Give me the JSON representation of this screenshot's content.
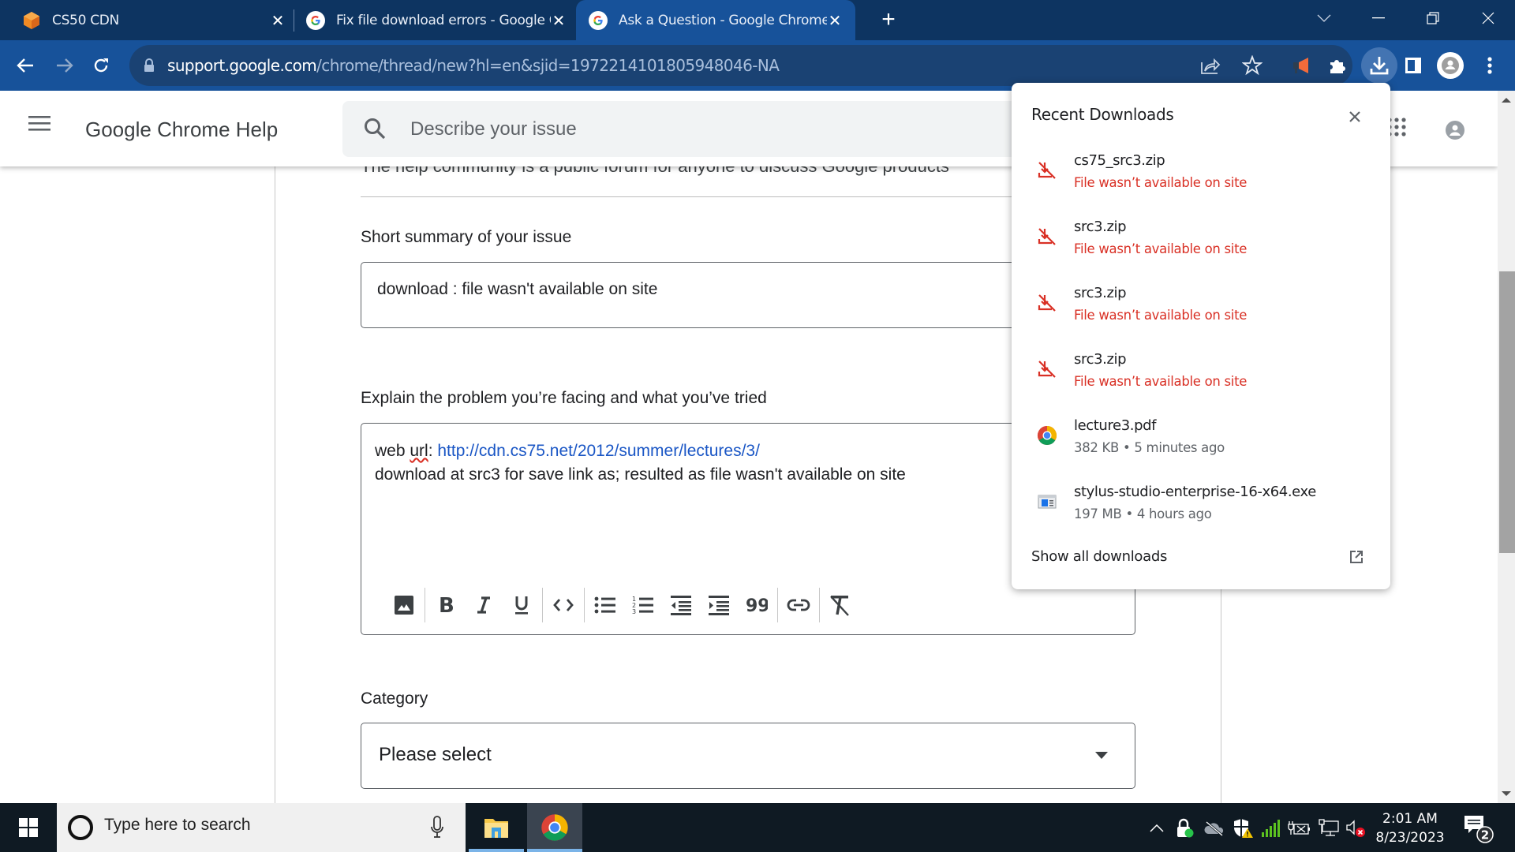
{
  "browser": {
    "tabs": [
      {
        "title": "CS50 CDN",
        "favicon": "cs50-cube-icon",
        "active": false
      },
      {
        "title": "Fix file download errors - Google Chrome Help",
        "favicon": "google-g-icon",
        "active": false
      },
      {
        "title": "Ask a Question - Google Chrome Help",
        "favicon": "google-g-icon",
        "active": true
      }
    ],
    "new_tab_label": "+",
    "url_host": "support.google.com",
    "url_path": "/chrome/thread/new?hl=en&sjid=1972214101805948046-NA",
    "toolbar_icons": [
      "back-icon",
      "forward-icon",
      "reload-icon",
      "share-icon",
      "bookmark-star-icon",
      "megaphone-extension-icon",
      "extensions-puzzle-icon",
      "downloads-icon",
      "side-panel-icon",
      "profile-icon",
      "menu-kebab-icon"
    ]
  },
  "page": {
    "site_title": "Google Chrome Help",
    "search_placeholder": "Describe your issue",
    "intro_text": "The help community is a public forum for anyone to discuss Google products",
    "summary_label": "Short summary of your issue",
    "summary_value": "download : file wasn't available on site",
    "details_label": "Explain the problem you’re facing and what you’ve tried",
    "details_prefix": "web ",
    "details_misspelled": "url",
    "details_colon": ": ",
    "details_link": "http://cdn.cs75.net/2012/summer/lectures/3/",
    "details_line2": "download at src3 for save link as; resulted as file wasn't available on site",
    "editor_tools": [
      "insert-image",
      "bold",
      "italic",
      "underline",
      "code",
      "bulleted-list",
      "numbered-list",
      "decrease-indent",
      "increase-indent",
      "quote",
      "link",
      "clear-formatting"
    ],
    "category_label": "Category",
    "category_value": "Please select"
  },
  "downloads": {
    "title": "Recent Downloads",
    "items": [
      {
        "name": "cs75_src3.zip",
        "status": "File wasn’t available on site",
        "state": "error"
      },
      {
        "name": "src3.zip",
        "status": "File wasn’t available on site",
        "state": "error"
      },
      {
        "name": "src3.zip",
        "status": "File wasn’t available on site",
        "state": "error"
      },
      {
        "name": "src3.zip",
        "status": "File wasn’t available on site",
        "state": "error"
      },
      {
        "name": "lecture3.pdf",
        "status": "382 KB • 5 minutes ago",
        "state": "complete"
      },
      {
        "name": "stylus-studio-enterprise-16-x64.exe",
        "status": "197 MB • 4 hours ago",
        "state": "complete"
      }
    ],
    "show_all_label": "Show all downloads",
    "error_color": "#d93025"
  },
  "taskbar": {
    "search_placeholder": "Type here to search",
    "time": "2:01 AM",
    "date": "8/23/2023",
    "notification_count": "2"
  }
}
